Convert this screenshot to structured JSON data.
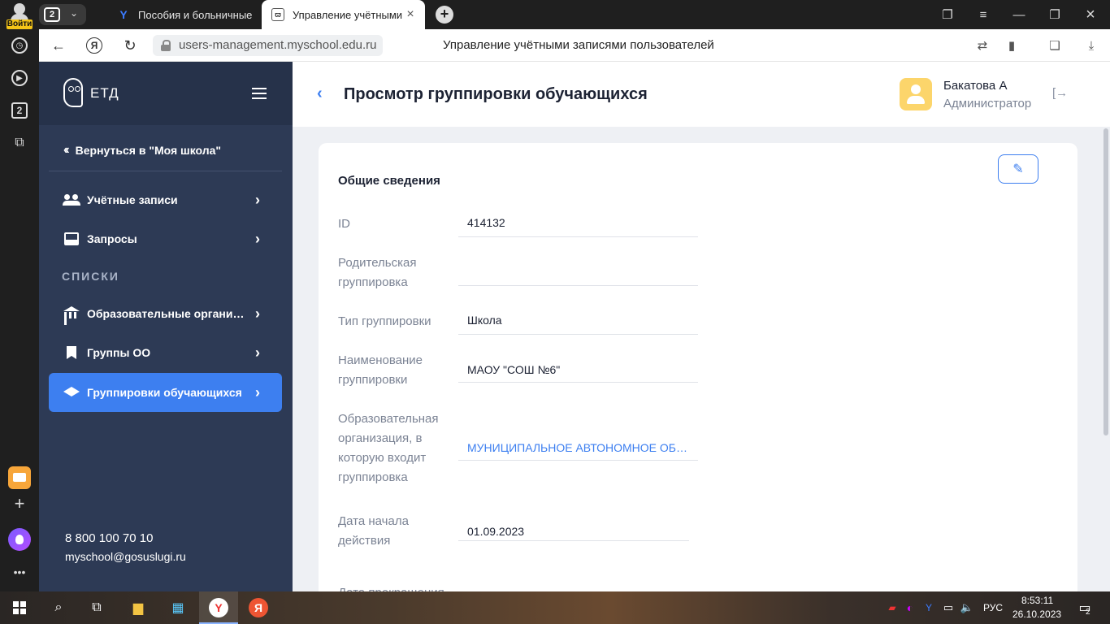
{
  "browser": {
    "login_badge": "Войти",
    "tab_count": "2",
    "side_badge": "2",
    "tabs": [
      {
        "title": "Пособия и больничные",
        "icon": "Y"
      },
      {
        "title": "Управление учётными записями пользователей",
        "icon": "owl"
      }
    ],
    "url": "users-management.myschool.edu.ru",
    "page_title": "Управление учётными записями пользователей"
  },
  "sidebar": {
    "brand": "ЕТД",
    "back_label": "Вернуться в \"Моя школа\"",
    "items": [
      {
        "label": "Учётные записи",
        "icon": "users-icon"
      },
      {
        "label": "Запросы",
        "icon": "inbox-icon"
      }
    ],
    "section_title": "СПИСКИ",
    "list_items": [
      {
        "label": "Образовательные организации",
        "icon": "bank-icon"
      },
      {
        "label": "Группы ОО",
        "icon": "bookmark-icon"
      },
      {
        "label": "Группировки обучающихся",
        "icon": "graduation-cap-icon",
        "active": true
      }
    ],
    "phone": "8 800 100 70 10",
    "email": "myschool@gosuslugi.ru"
  },
  "header": {
    "title": "Просмотр группировки обучающихся",
    "user_name": "Бакатова А",
    "user_role": "Администратор"
  },
  "card": {
    "section_title": "Общие сведения",
    "fields": [
      {
        "label": "ID",
        "value": "414132"
      },
      {
        "label": "Родительская группировка",
        "value": ""
      },
      {
        "label": "Тип группировки",
        "value": "Школа"
      },
      {
        "label": "Наименование группировки",
        "value": "МАОУ \"СОШ №6\""
      },
      {
        "label": "Образовательная организация, в которую входит группировка",
        "value": "МУНИЦИПАЛЬНОЕ АВТОНОМНОЕ ОБЩЕОБРАЗОВАТЕЛЬНОЕ УЧРЕЖДЕНИЕ"
      },
      {
        "label": "Дата начала действия",
        "value": "01.09.2023"
      },
      {
        "label": "Дата прекращения",
        "value": ""
      }
    ]
  },
  "taskbar": {
    "language": "РУС",
    "time": "8:53:11",
    "date": "26.10.2023",
    "notifications": "2"
  },
  "colors": {
    "accent": "#3d7ff0",
    "sidebar_bg": "#2d3a55",
    "avatar": "#fcd56b"
  }
}
